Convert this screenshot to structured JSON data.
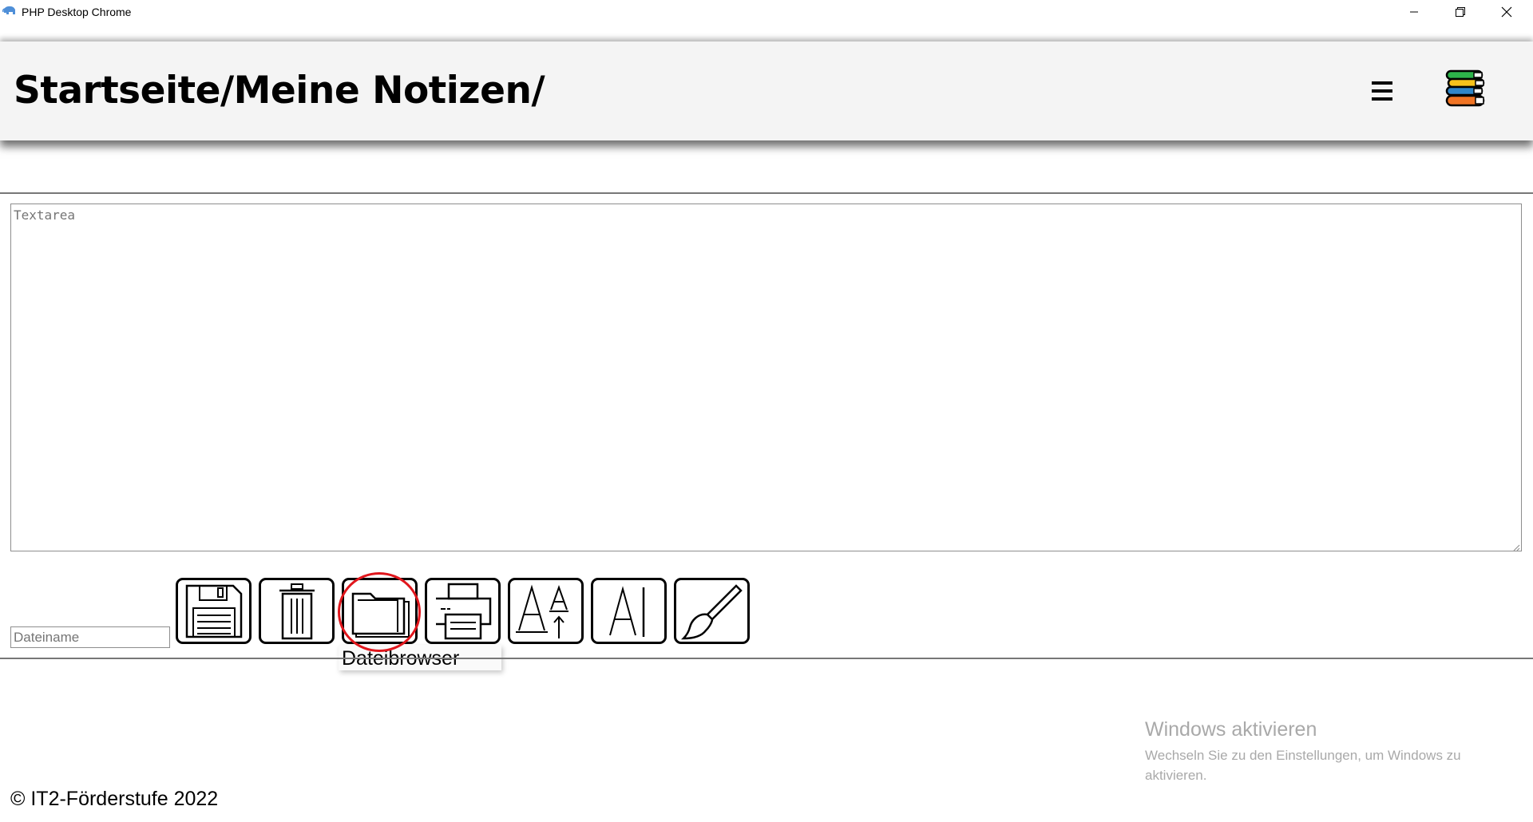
{
  "window": {
    "title": "PHP Desktop Chrome",
    "icon": "php-elephant-icon",
    "controls": [
      "minimize-icon",
      "restore-icon",
      "close-icon"
    ]
  },
  "header": {
    "breadcrumb": "Startseite/Meine Notizen/",
    "menu_icon": "hamburger-menu-icon",
    "logo_icon": "books-stack-logo",
    "background": "#f4f4f4"
  },
  "editor": {
    "textarea_placeholder": "Textarea",
    "textarea_value": ""
  },
  "toolbar": {
    "filename_placeholder": "Dateiname",
    "filename_value": "",
    "buttons": [
      {
        "icon": "floppy-disk-icon",
        "action": "save"
      },
      {
        "icon": "trash-icon",
        "action": "delete"
      },
      {
        "icon": "folder-icon",
        "action": "file-browser"
      },
      {
        "icon": "printer-icon",
        "action": "print"
      },
      {
        "icon": "font-size-icon",
        "action": "font-size"
      },
      {
        "icon": "text-cursor-icon",
        "action": "font"
      },
      {
        "icon": "paintbrush-icon",
        "action": "color"
      }
    ],
    "tooltip": "Dateibrowser",
    "highlight_color": "#e0161c"
  },
  "watermark": {
    "title": "Windows aktivieren",
    "subtitle": "Wechseln Sie zu den Einstellungen, um Windows zu aktivieren."
  },
  "footer": {
    "copyright": "© IT2-Förderstufe 2022"
  }
}
